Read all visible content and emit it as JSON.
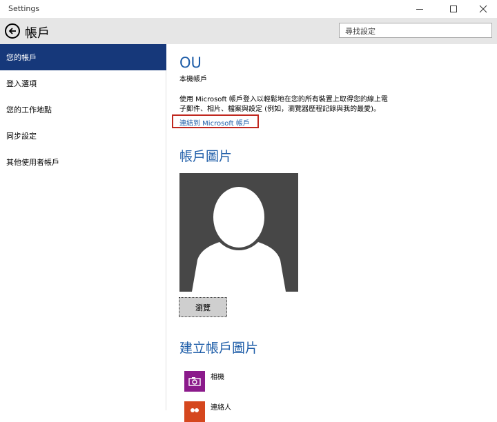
{
  "window": {
    "title": "Settings"
  },
  "header": {
    "page_title": "帳戶",
    "search_placeholder": "尋找設定"
  },
  "sidebar": {
    "items": [
      {
        "label": "您的帳戶",
        "active": true
      },
      {
        "label": "登入選項",
        "active": false
      },
      {
        "label": "您的工作地點",
        "active": false
      },
      {
        "label": "同步設定",
        "active": false
      },
      {
        "label": "其他使用者帳戶",
        "active": false
      }
    ]
  },
  "main": {
    "user_name": "OU",
    "account_type": "本機帳戶",
    "description_line1": "使用 Microsoft 帳戶登入以輕鬆地在您的所有裝置上取得您的線上電",
    "description_line2": "子郵件、相片、檔案與設定 (例如，瀏覽器歷程記錄與我的最愛)。",
    "connect_link": "連結到 Microsoft 帳戶",
    "account_picture_title": "帳戶圖片",
    "browse_label": "瀏覽",
    "create_picture_title": "建立帳戶圖片",
    "apps": [
      {
        "label": "相機",
        "icon": "camera-icon",
        "color": "#8b1a8b"
      },
      {
        "label": "連絡人",
        "icon": "people-icon",
        "color": "#d5471e"
      }
    ]
  },
  "colors": {
    "accent": "#16387a",
    "link": "#1e5da8",
    "highlight_box": "#c0271f",
    "header_bg": "#e6e6e6"
  }
}
